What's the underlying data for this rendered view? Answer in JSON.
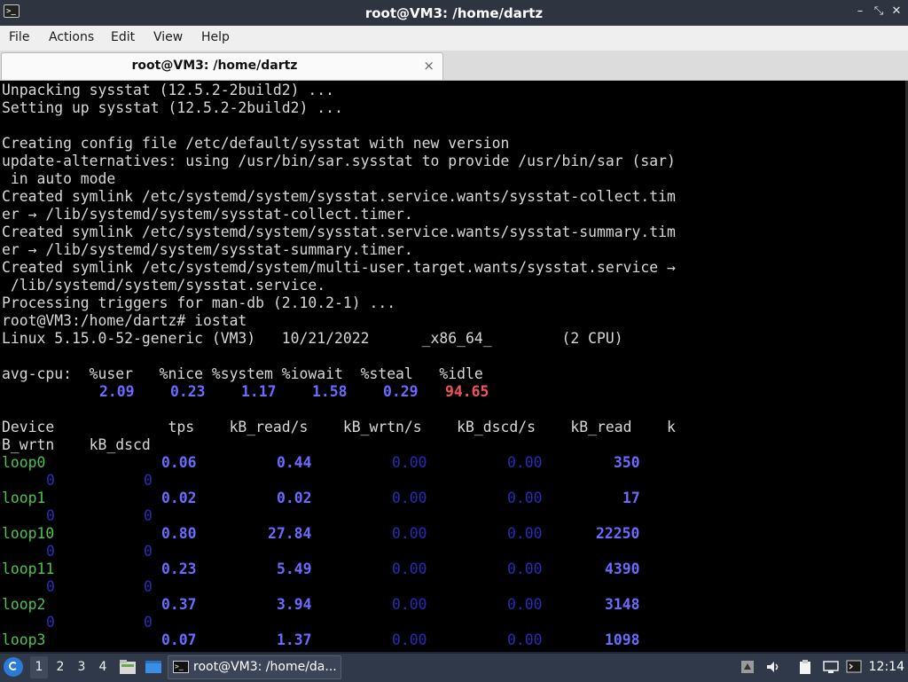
{
  "window": {
    "title": "root@VM3: /home/dartz",
    "app_icon_glyph": ">_",
    "controls": {
      "minimize": "–",
      "restore": "⤡",
      "close": "✕"
    }
  },
  "menubar": {
    "items": [
      "File",
      "Actions",
      "Edit",
      "View",
      "Help"
    ]
  },
  "tabs": [
    {
      "label": "root@VM3: /home/dartz",
      "close": "×"
    }
  ],
  "terminal": {
    "lines": [
      [
        {
          "t": "Unpacking sysstat (12.5.2-2build2) ...",
          "c": "norm",
          "col": 0
        }
      ],
      [
        {
          "t": "Setting up sysstat (12.5.2-2build2) ...",
          "c": "norm",
          "col": 0
        }
      ],
      [],
      [
        {
          "t": "Creating config file /etc/default/sysstat with new version",
          "c": "norm",
          "col": 0
        }
      ],
      [
        {
          "t": "update-alternatives: using /usr/bin/sar.sysstat to provide /usr/bin/sar (sar)",
          "c": "norm",
          "col": 0
        }
      ],
      [
        {
          "t": " in auto mode",
          "c": "norm",
          "col": 0
        }
      ],
      [
        {
          "t": "Created symlink /etc/systemd/system/sysstat.service.wants/sysstat-collect.tim",
          "c": "norm",
          "col": 0
        }
      ],
      [
        {
          "t": "er → /lib/systemd/system/sysstat-collect.timer.",
          "c": "norm",
          "col": 0
        }
      ],
      [
        {
          "t": "Created symlink /etc/systemd/system/sysstat.service.wants/sysstat-summary.tim",
          "c": "norm",
          "col": 0
        }
      ],
      [
        {
          "t": "er → /lib/systemd/system/sysstat-summary.timer.",
          "c": "norm",
          "col": 0
        }
      ],
      [
        {
          "t": "Created symlink /etc/systemd/system/multi-user.target.wants/sysstat.service →",
          "c": "norm",
          "col": 0
        }
      ],
      [
        {
          "t": " /lib/systemd/system/sysstat.service.",
          "c": "norm",
          "col": 0
        }
      ],
      [
        {
          "t": "Processing triggers for man-db (2.10.2-1) ...",
          "c": "norm",
          "col": 0
        }
      ],
      [
        {
          "t": "root@VM3:/home/dartz# iostat",
          "c": "norm",
          "col": 0
        }
      ],
      [
        {
          "t": "Linux 5.15.0-52-generic (VM3)   10/21/2022      _x86_64_        (2 CPU)",
          "c": "norm",
          "col": 0
        }
      ],
      [],
      [
        {
          "t": "avg-cpu:  %user   %nice %system %iowait  %steal   %idle",
          "c": "norm",
          "col": 0
        }
      ],
      [
        {
          "t": "2.09",
          "c": "blue",
          "col": 11
        },
        {
          "t": "0.23",
          "c": "blue",
          "col": 19
        },
        {
          "t": "1.17",
          "c": "blue",
          "col": 27
        },
        {
          "t": "1.58",
          "c": "blue",
          "col": 35
        },
        {
          "t": "0.29",
          "c": "blue",
          "col": 43
        },
        {
          "t": "94.65",
          "c": "red",
          "col": 50
        }
      ],
      [],
      [
        {
          "t": "Device             tps    kB_read/s    kB_wrtn/s    kB_dscd/s    kB_read    k",
          "c": "norm",
          "col": 0
        }
      ],
      [
        {
          "t": "B_wrtn    kB_dscd",
          "c": "norm",
          "col": 0
        }
      ],
      [
        {
          "t": "loop0",
          "c": "green",
          "col": 0
        },
        {
          "t": "0.06",
          "c": "blue",
          "col": 18
        },
        {
          "t": "0.44",
          "c": "blue",
          "col": 31
        },
        {
          "t": "0.00",
          "c": "dim",
          "col": 44
        },
        {
          "t": "0.00",
          "c": "dim",
          "col": 57
        },
        {
          "t": "350",
          "c": "blue",
          "col": 69
        }
      ],
      [
        {
          "t": "0",
          "c": "dim",
          "col": 5
        },
        {
          "t": "0",
          "c": "dim",
          "col": 16
        }
      ],
      [
        {
          "t": "loop1",
          "c": "green",
          "col": 0
        },
        {
          "t": "0.02",
          "c": "blue",
          "col": 18
        },
        {
          "t": "0.02",
          "c": "blue",
          "col": 31
        },
        {
          "t": "0.00",
          "c": "dim",
          "col": 44
        },
        {
          "t": "0.00",
          "c": "dim",
          "col": 57
        },
        {
          "t": "17",
          "c": "blue",
          "col": 70
        }
      ],
      [
        {
          "t": "0",
          "c": "dim",
          "col": 5
        },
        {
          "t": "0",
          "c": "dim",
          "col": 16
        }
      ],
      [
        {
          "t": "loop10",
          "c": "green",
          "col": 0
        },
        {
          "t": "0.80",
          "c": "blue",
          "col": 18
        },
        {
          "t": "27.84",
          "c": "blue",
          "col": 30
        },
        {
          "t": "0.00",
          "c": "dim",
          "col": 44
        },
        {
          "t": "0.00",
          "c": "dim",
          "col": 57
        },
        {
          "t": "22250",
          "c": "blue",
          "col": 67
        }
      ],
      [
        {
          "t": "0",
          "c": "dim",
          "col": 5
        },
        {
          "t": "0",
          "c": "dim",
          "col": 16
        }
      ],
      [
        {
          "t": "loop11",
          "c": "green",
          "col": 0
        },
        {
          "t": "0.23",
          "c": "blue",
          "col": 18
        },
        {
          "t": "5.49",
          "c": "blue",
          "col": 31
        },
        {
          "t": "0.00",
          "c": "dim",
          "col": 44
        },
        {
          "t": "0.00",
          "c": "dim",
          "col": 57
        },
        {
          "t": "4390",
          "c": "blue",
          "col": 68
        }
      ],
      [
        {
          "t": "0",
          "c": "dim",
          "col": 5
        },
        {
          "t": "0",
          "c": "dim",
          "col": 16
        }
      ],
      [
        {
          "t": "loop2",
          "c": "green",
          "col": 0
        },
        {
          "t": "0.37",
          "c": "blue",
          "col": 18
        },
        {
          "t": "3.94",
          "c": "blue",
          "col": 31
        },
        {
          "t": "0.00",
          "c": "dim",
          "col": 44
        },
        {
          "t": "0.00",
          "c": "dim",
          "col": 57
        },
        {
          "t": "3148",
          "c": "blue",
          "col": 68
        }
      ],
      [
        {
          "t": "0",
          "c": "dim",
          "col": 5
        },
        {
          "t": "0",
          "c": "dim",
          "col": 16
        }
      ],
      [
        {
          "t": "loop3",
          "c": "green",
          "col": 0
        },
        {
          "t": "0.07",
          "c": "blue",
          "col": 18
        },
        {
          "t": "1.37",
          "c": "blue",
          "col": 31
        },
        {
          "t": "0.00",
          "c": "dim",
          "col": 44
        },
        {
          "t": "0.00",
          "c": "dim",
          "col": 57
        },
        {
          "t": "1098",
          "c": "blue",
          "col": 68
        }
      ]
    ]
  },
  "taskbar": {
    "workspaces": [
      "1",
      "2",
      "3",
      "4"
    ],
    "active_workspace": "1",
    "task_label": "root@VM3: /home/da...",
    "clock": "12:14",
    "tray_icons": [
      "usb-drive-icon",
      "volume-icon",
      "clipboard-icon",
      "network-display-icon",
      "terminal-tray-icon"
    ]
  },
  "colors": {
    "blue": "#6b6bff",
    "red": "#f2545b",
    "green": "#4fc34f",
    "dim": "#2a2ab8",
    "terminal_bg": "#000000"
  }
}
